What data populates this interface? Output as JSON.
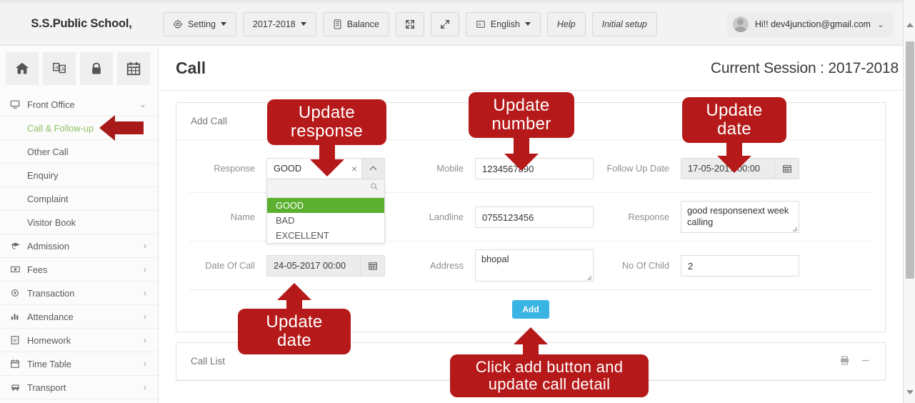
{
  "header": {
    "brand": "S.S.Public School,",
    "buttons": [
      {
        "label": "Setting",
        "icon": "gear-icon",
        "caret": true
      },
      {
        "label": "2017-2018",
        "icon": null,
        "caret": true
      },
      {
        "label": "Balance",
        "icon": "book-icon",
        "caret": false
      },
      {
        "label": "",
        "icon": "collapse-icon",
        "caret": false
      },
      {
        "label": "",
        "icon": "expand-icon",
        "caret": false
      },
      {
        "label": "English",
        "icon": "flag-icon",
        "caret": true
      },
      {
        "label": "Help",
        "icon": null,
        "caret": false
      },
      {
        "label": "Initial setup",
        "icon": null,
        "caret": false
      }
    ],
    "user": "Hi!! dev4junction@gmail.com",
    "user_chevron": "⌄"
  },
  "sidebar": {
    "icon_tiles": [
      "home-icon",
      "translate-icon",
      "lock-icon",
      "calendar-icon"
    ],
    "items": [
      {
        "label": "Front Office",
        "icon": "monitor-icon",
        "arrow": "⌄",
        "active": false,
        "sub": false
      },
      {
        "label": "Call & Follow-up",
        "icon": null,
        "arrow": "",
        "active": true,
        "sub": true
      },
      {
        "label": "Other Call",
        "icon": null,
        "arrow": "",
        "active": false,
        "sub": true
      },
      {
        "label": "Enquiry",
        "icon": null,
        "arrow": "",
        "active": false,
        "sub": true
      },
      {
        "label": "Complaint",
        "icon": null,
        "arrow": "",
        "active": false,
        "sub": true
      },
      {
        "label": "Visitor Book",
        "icon": null,
        "arrow": "",
        "active": false,
        "sub": true
      },
      {
        "label": "Admission",
        "icon": "graduation-icon",
        "arrow": "›",
        "active": false,
        "sub": false
      },
      {
        "label": "Fees",
        "icon": "money-icon",
        "arrow": "›",
        "active": false,
        "sub": false
      },
      {
        "label": "Transaction",
        "icon": "gear-icon",
        "arrow": "›",
        "active": false,
        "sub": false
      },
      {
        "label": "Attendance",
        "icon": "chart-icon",
        "arrow": "›",
        "active": false,
        "sub": false
      },
      {
        "label": "Homework",
        "icon": "document-icon",
        "arrow": "›",
        "active": false,
        "sub": false
      },
      {
        "label": "Time Table",
        "icon": "calendar-icon",
        "arrow": "›",
        "active": false,
        "sub": false
      },
      {
        "label": "Transport",
        "icon": "bus-icon",
        "arrow": "›",
        "active": false,
        "sub": false
      }
    ]
  },
  "page": {
    "title": "Call",
    "session": "Current Session : 2017-2018"
  },
  "add_call": {
    "panel_title": "Add Call",
    "labels": {
      "response_select": "Response",
      "name": "Name",
      "date_of_call": "Date Of Call",
      "mobile": "Mobile",
      "landline": "Landline",
      "address": "Address",
      "follow_up_date": "Follow Up Date",
      "response_text": "Response",
      "no_of_child": "No Of Child"
    },
    "response_select": {
      "value": "GOOD",
      "clear": "×",
      "open": true,
      "search_value": "",
      "options": [
        "GOOD",
        "BAD",
        "EXCELLENT"
      ],
      "selected_index": 0,
      "highlight_color": "#5cb030"
    },
    "name": "",
    "date_of_call": "24-05-2017 00:00",
    "mobile": "1234567890",
    "landline": "0755123456",
    "address": "bhopal",
    "follow_up_date": "17-05-2017 00:00",
    "response_text": "good responsenext week calling",
    "no_of_child": "2",
    "add_button": "Add",
    "add_button_color": "#3ab4e3"
  },
  "call_list": {
    "panel_title": "Call List",
    "tools": [
      "print-icon",
      "minimize-icon"
    ]
  },
  "annotations": {
    "color": "#b61919",
    "items": [
      {
        "name": "update-response",
        "lines": [
          "Update",
          "response"
        ]
      },
      {
        "name": "update-number",
        "lines": [
          "Update",
          "number"
        ]
      },
      {
        "name": "update-date-followup",
        "lines": [
          "Update",
          "date"
        ]
      },
      {
        "name": "update-date-call",
        "lines": [
          "Update",
          "date"
        ]
      },
      {
        "name": "click-add-button",
        "lines": [
          "Click add button and",
          "update call detail"
        ]
      }
    ]
  }
}
